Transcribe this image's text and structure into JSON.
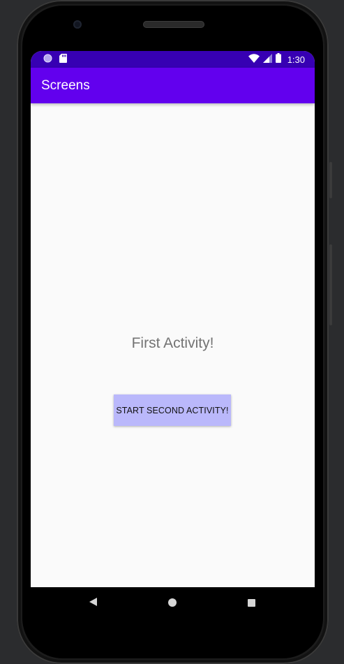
{
  "status_bar": {
    "time": "1:30",
    "left_icons": [
      "circle-notification-icon",
      "sd-card-icon"
    ],
    "right_icons": [
      "wifi-icon",
      "cell-signal-icon",
      "battery-icon"
    ],
    "color": "#3700b3"
  },
  "app_bar": {
    "title": "Screens",
    "color": "#6200ee"
  },
  "main": {
    "heading": "First Activity!",
    "button_label": "START SECOND ACTIVITY!",
    "button_color": "#bab8fb"
  },
  "nav_bar": {
    "icons": [
      "back-icon",
      "home-icon",
      "recents-icon"
    ]
  }
}
